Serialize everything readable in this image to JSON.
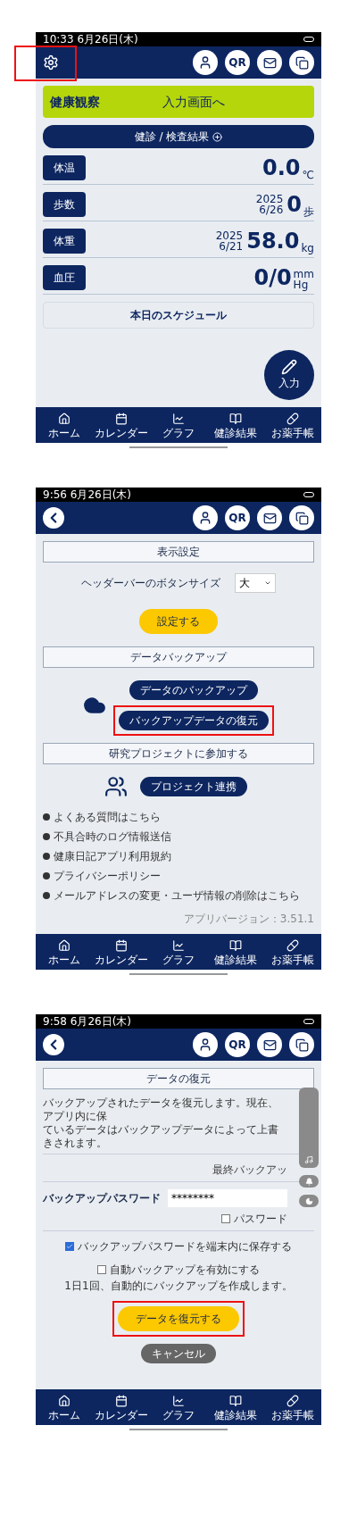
{
  "screens": [
    {
      "kind": "home",
      "status_time": "10:33 6月26日(木)",
      "highlight_left": true,
      "qr_label": "QR",
      "banner": {
        "logo": "健康観察",
        "label": "入力画面へ"
      },
      "results_button": "健診 / 検査結果",
      "vitals": [
        {
          "label": "体温",
          "value": "0.0",
          "unit": [
            "℃"
          ]
        },
        {
          "label": "歩数",
          "date": [
            "2025",
            "6/26"
          ],
          "value": "0",
          "unit": [
            "歩"
          ]
        },
        {
          "label": "体重",
          "date": [
            "2025",
            "6/21"
          ],
          "value": "58.0",
          "unit": [
            "kg"
          ]
        },
        {
          "label": "血圧",
          "value": "0/0",
          "unit": [
            "mm",
            "Hg"
          ]
        }
      ],
      "schedule": "本日のスケジュール",
      "fab": "入力",
      "nav": [
        {
          "kind": "home",
          "label": "ホーム"
        },
        {
          "kind": "calendar",
          "label": "カレンダー"
        },
        {
          "kind": "graph",
          "label": "グラフ"
        },
        {
          "kind": "book",
          "label": "健診結果"
        },
        {
          "kind": "pill",
          "label": "お薬手帳"
        }
      ]
    },
    {
      "kind": "settings",
      "status_time": "9:56 6月26日(木)",
      "qr_label": "QR",
      "items": [
        {
          "kind": "section",
          "text": "表示設定"
        },
        {
          "kind": "select",
          "label": "ヘッダーバーのボタンサイズ",
          "value": "大"
        },
        {
          "kind": "primary",
          "text": "設定する",
          "highlighted": false
        },
        {
          "kind": "section",
          "text": "データバックアップ"
        },
        {
          "kind": "backup_actions",
          "buttons": [
            {
              "text": "データのバックアップ",
              "highlighted": false
            },
            {
              "text": "バックアップデータの復元",
              "highlighted": true
            }
          ]
        },
        {
          "kind": "section",
          "text": "研究プロジェクトに参加する"
        },
        {
          "kind": "project_actions",
          "buttons": [
            {
              "text": "プロジェクト連携",
              "highlighted": false
            }
          ]
        },
        {
          "kind": "links",
          "links": [
            "よくある質問はこちら",
            "不具合時のログ情報送信",
            "健康日記アプリ利用規約",
            "プライバシーポリシー",
            "メールアドレスの変更・ユーザ情報の削除はこちら"
          ]
        },
        {
          "kind": "version",
          "text": "アプリバージョン：3.51.1"
        }
      ],
      "nav": [
        {
          "kind": "home",
          "label": "ホーム"
        },
        {
          "kind": "calendar",
          "label": "カレンダー"
        },
        {
          "kind": "graph",
          "label": "グラフ"
        },
        {
          "kind": "book",
          "label": "健診結果"
        },
        {
          "kind": "pill",
          "label": "お薬手帳"
        }
      ]
    },
    {
      "kind": "restore",
      "status_time": "9:58 6月26日(木)",
      "qr_label": "QR",
      "items": [
        {
          "kind": "section",
          "text": "データの復元"
        },
        {
          "kind": "paragraph",
          "lines": [
            "バックアップされたデータを復元します。現在、アプリ内に保",
            "ているデータはバックアップデータによって上書きされます。"
          ]
        },
        {
          "kind": "note_right",
          "text": "最終バックアッ"
        },
        {
          "kind": "password",
          "label": "バックアップパスワード",
          "value": "********",
          "show_label": "パスワード",
          "show_checked": false
        },
        {
          "kind": "checkbox",
          "text": "バックアップパスワードを端末内に保存する",
          "checked": true
        },
        {
          "kind": "checkbox",
          "text": "自動バックアップを有効にする",
          "checked": false,
          "note": "1日1回、自動的にバックアップを作成します。"
        },
        {
          "kind": "primary",
          "text": "データを復元する",
          "highlighted": true
        },
        {
          "kind": "secondary",
          "text": "キャンセル"
        }
      ],
      "nav": [
        {
          "kind": "home",
          "label": "ホーム"
        },
        {
          "kind": "calendar",
          "label": "カレンダー"
        },
        {
          "kind": "graph",
          "label": "グラフ"
        },
        {
          "kind": "book",
          "label": "健診結果"
        },
        {
          "kind": "pill",
          "label": "お薬手帳"
        }
      ]
    }
  ]
}
